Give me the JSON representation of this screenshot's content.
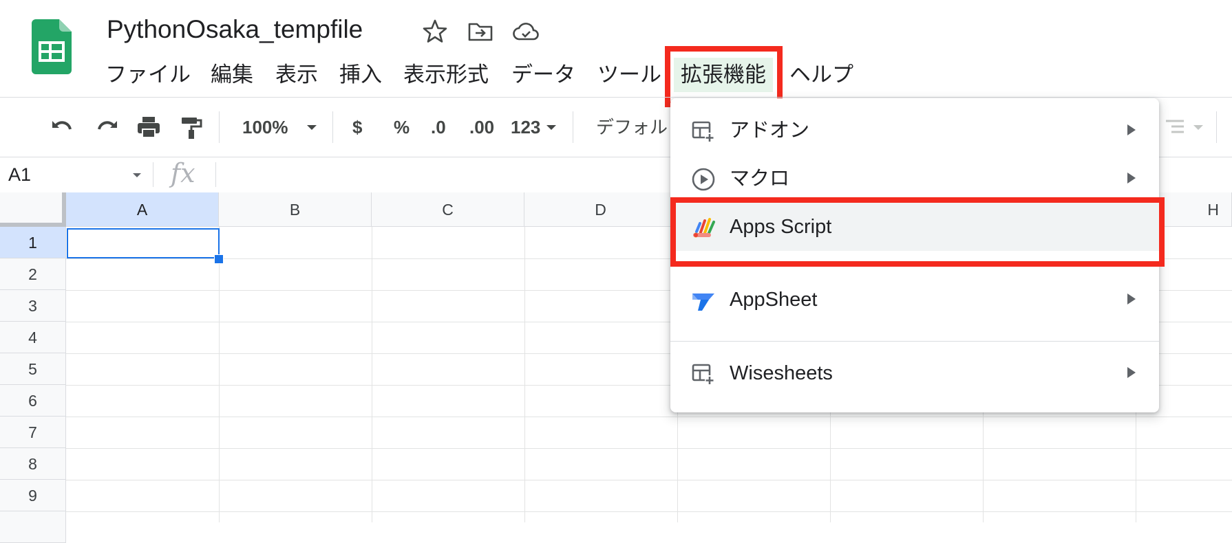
{
  "doc": {
    "title": "PythonOsaka_tempfile"
  },
  "menu": [
    "ファイル",
    "編集",
    "表示",
    "挿入",
    "表示形式",
    "データ",
    "ツール",
    "拡張機能",
    "ヘルプ"
  ],
  "toolbar": {
    "zoom": "100%",
    "currency": "$",
    "percent": "%",
    "decimal_decrease": ".0",
    "decimal_increase": ".00",
    "more_formats": "123",
    "font": "デフォル"
  },
  "formula_bar": {
    "cell_ref": "A1",
    "fx": "fx"
  },
  "grid": {
    "columns": [
      "A",
      "B",
      "C",
      "D",
      "H"
    ],
    "rows": [
      "1",
      "2",
      "3",
      "4",
      "5",
      "6",
      "7",
      "8",
      "9"
    ],
    "selected_cell": "A1"
  },
  "extensions_menu": {
    "items": [
      {
        "label": "アドオン",
        "icon": "addon-icon",
        "submenu": true
      },
      {
        "label": "マクロ",
        "icon": "macro-play-icon",
        "submenu": true
      },
      {
        "label": "Apps Script",
        "icon": "apps-script-icon",
        "submenu": false
      },
      {
        "label": "AppSheet",
        "icon": "appsheet-icon",
        "submenu": true
      },
      {
        "label": "Wisesheets",
        "icon": "addon-icon",
        "submenu": true
      }
    ]
  },
  "colors": {
    "highlight": "#f42a1e",
    "sheets_green": "#23a566",
    "selection_blue": "#1a73e8"
  }
}
